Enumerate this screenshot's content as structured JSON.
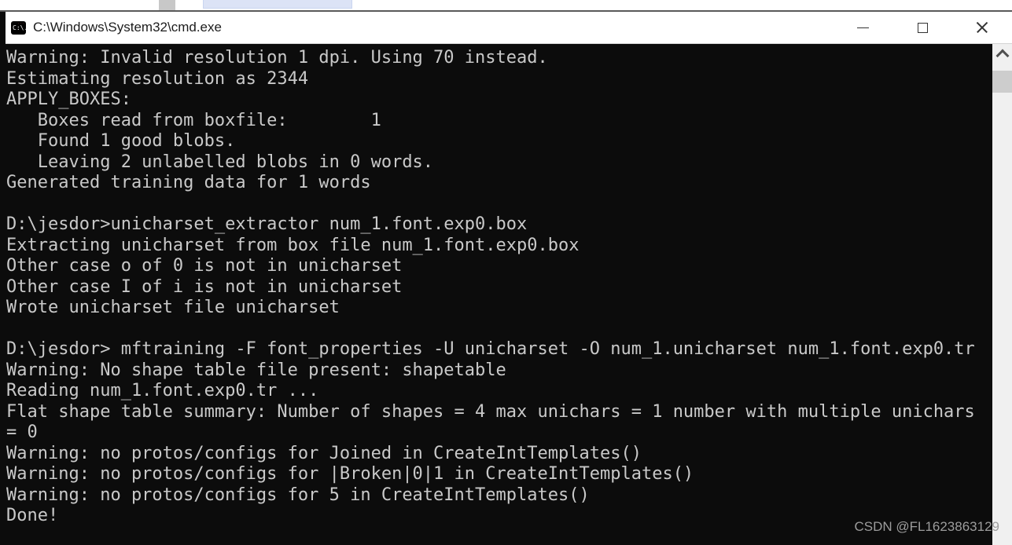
{
  "window": {
    "title": "C:\\Windows\\System32\\cmd.exe",
    "controls": [
      "minimize",
      "maximize",
      "close"
    ],
    "icon": "cmd-icon",
    "icon_prompt": "C:\\.",
    "titlebar_background": "#ffffff"
  },
  "background_fragments": {
    "gray_color": "#c8c8c8",
    "blue_color": "#dce3f6"
  },
  "console": {
    "background": "#0c0c0c",
    "text_color": "#c9c9c9",
    "lines": [
      "Warning: Invalid resolution 1 dpi. Using 70 instead.",
      "Estimating resolution as 2344",
      "APPLY_BOXES:",
      "   Boxes read from boxfile:        1",
      "   Found 1 good blobs.",
      "   Leaving 2 unlabelled blobs in 0 words.",
      "Generated training data for 1 words",
      "",
      "D:\\jesdor>unicharset_extractor num_1.font.exp0.box",
      "Extracting unicharset from box file num_1.font.exp0.box",
      "Other case o of 0 is not in unicharset",
      "Other case I of i is not in unicharset",
      "Wrote unicharset file unicharset",
      "",
      "D:\\jesdor> mftraining -F font_properties -U unicharset -O num_1.unicharset num_1.font.exp0.tr",
      "Warning: No shape table file present: shapetable",
      "Reading num_1.font.exp0.tr ...",
      "Flat shape table summary: Number of shapes = 4 max unichars = 1 number with multiple unichars",
      "= 0",
      "Warning: no protos/configs for Joined in CreateIntTemplates()",
      "Warning: no protos/configs for |Broken|0|1 in CreateIntTemplates()",
      "Warning: no protos/configs for 5 in CreateIntTemplates()",
      "Done!"
    ]
  },
  "scrollbar": {
    "track_color": "#f0f0f0",
    "thumb_color": "#cdcdcd"
  },
  "watermark": {
    "text": "CSDN @FL1623863129",
    "color": "#9c9c9c"
  }
}
